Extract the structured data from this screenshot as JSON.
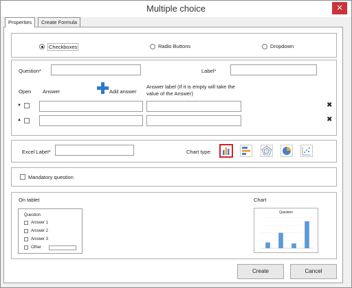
{
  "window": {
    "title": "Multiple choice",
    "close_glyph": "✕"
  },
  "tabs": [
    {
      "label": "Properties"
    },
    {
      "label": "Create Formula"
    }
  ],
  "type_options": [
    {
      "label": "Checkboxes",
      "selected": true
    },
    {
      "label": "Radio Buttons",
      "selected": false
    },
    {
      "label": "Dropdown",
      "selected": false
    }
  ],
  "question_section": {
    "question_label": "Question*",
    "label_label": "Label*",
    "question_value": "",
    "label_value": "",
    "open_header": "Open",
    "answer_header": "Answer",
    "add_answer_label": "Add answer",
    "answer_label_header": "Answer label (If it is empty will take the value of the Answer)",
    "rows": [
      {
        "arrow": "▼",
        "answer": "",
        "label": "",
        "delete": "✖"
      },
      {
        "arrow": "▲",
        "answer": "",
        "label": "",
        "delete": "✖"
      }
    ]
  },
  "excel_section": {
    "excel_label": "Excel Label*",
    "excel_value": "",
    "chart_type_label": "Chart type:",
    "chart_types": [
      "bar-chart-icon",
      "horizontal-bar-chart-icon",
      "radar-chart-icon",
      "pie-chart-icon",
      "scatter-chart-icon"
    ],
    "selected_chart_type": "bar-chart-icon"
  },
  "mandatory": {
    "label": "Mandatory question",
    "checked": false
  },
  "preview": {
    "tablet_title": "On tablet",
    "tablet_question": "Question",
    "tablet_answers": [
      "Answer 1",
      "Answer 2",
      "Answer 3"
    ],
    "tablet_other": "Other",
    "chart_title": "Chart",
    "chart_mini_title": "Question"
  },
  "chart_data": {
    "type": "bar",
    "title": "Question",
    "categories": [
      "",
      "",
      "",
      ""
    ],
    "values": [
      3,
      8,
      2.5,
      14
    ],
    "ylim": [
      0,
      16
    ]
  },
  "buttons": {
    "create": "Create",
    "cancel": "Cancel"
  },
  "colors": {
    "accent": "#d12027",
    "bar": "#5b9bd5",
    "add_icon": "#2b7bc9"
  }
}
